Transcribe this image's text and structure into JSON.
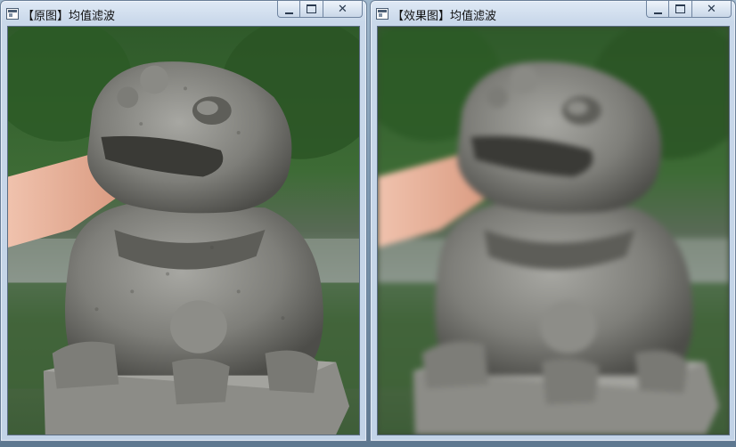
{
  "windows": [
    {
      "title": "【原图】均值滤波",
      "image": "stone lion statue photo, original"
    },
    {
      "title": "【效果图】均值滤波",
      "image": "stone lion statue photo, blurred with mean filter"
    }
  ],
  "controls": {
    "minimize": "minimize-icon",
    "maximize": "maximize-icon",
    "close": "close-icon"
  }
}
